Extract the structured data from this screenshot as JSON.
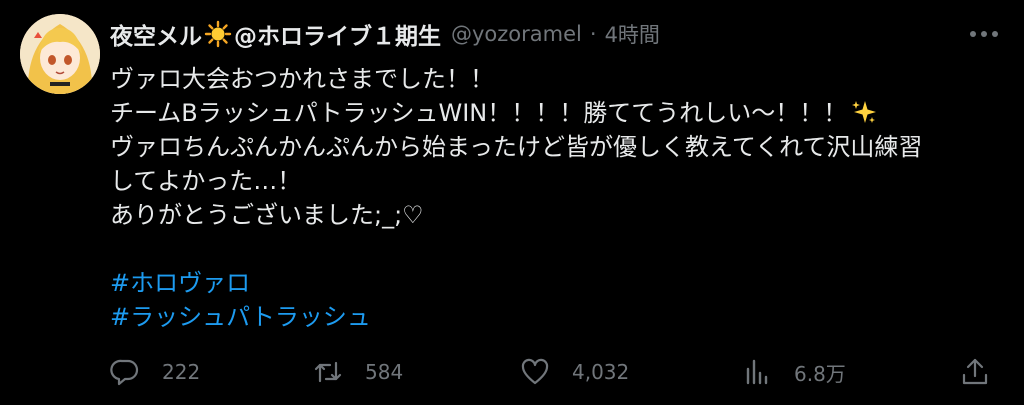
{
  "tweet": {
    "display_name": "夜空メル",
    "display_name_suffix": "@ホロライブ１期生",
    "handle": "@yozoramel",
    "separator": "·",
    "timestamp": "4時間",
    "lines": [
      "ヴァロ大会おつかれさまでした！！",
      "チームBラッシュパトラッシュWIN！！！！勝ててうれしい〜！！！",
      "ヴァロちんぷんかんぷんから始まったけど皆が優しく教えてくれて沢山練習",
      "してよかった…！",
      "ありがとうございました;_;♡"
    ],
    "hashtags": [
      "#ホロヴァロ",
      "#ラッシュパトラッシュ"
    ]
  },
  "actions": {
    "reply_count": "222",
    "retweet_count": "584",
    "like_count": "4,032",
    "view_count": "6.8万"
  },
  "icons": {
    "avatar": "avatar",
    "name_emoji": "sun-icon",
    "more": "more-icon",
    "sparkle": "sparkles-icon",
    "reply": "reply-icon",
    "retweet": "retweet-icon",
    "like": "heart-icon",
    "views": "views-icon",
    "share": "share-icon"
  },
  "colors": {
    "background": "#000000",
    "text": "#e7e9ea",
    "secondary": "#71767b",
    "hashtag": "#1d9bf0"
  }
}
